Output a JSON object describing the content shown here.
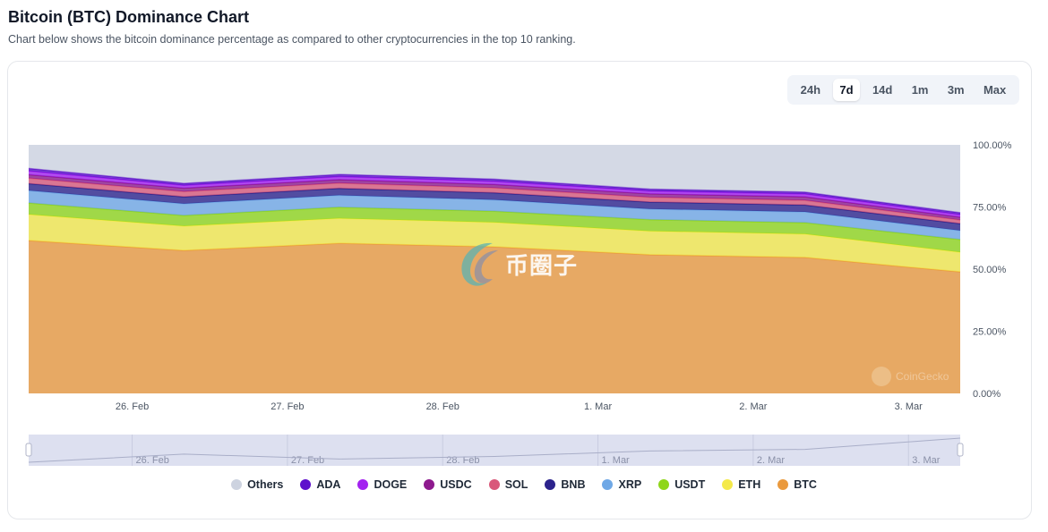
{
  "header": {
    "title": "Bitcoin (BTC) Dominance Chart",
    "subtitle": "Chart below shows the bitcoin dominance percentage as compared to other cryptocurrencies in the top 10 ranking."
  },
  "ranges": [
    {
      "label": "24h",
      "active": false
    },
    {
      "label": "7d",
      "active": true
    },
    {
      "label": "14d",
      "active": false
    },
    {
      "label": "1m",
      "active": false
    },
    {
      "label": "3m",
      "active": false
    },
    {
      "label": "Max",
      "active": false
    }
  ],
  "watermark": {
    "text": "币圈子",
    "brand": "CoinGecko"
  },
  "chart_data": {
    "type": "area",
    "stacked": true,
    "x": [
      "25 Feb 08:00",
      "26 Feb 08:00",
      "27 Feb 08:00",
      "28 Feb 08:00",
      "1 Mar 08:00",
      "2 Mar 08:00",
      "3 Mar 08:00"
    ],
    "x_tick_labels": [
      "26. Feb",
      "27. Feb",
      "28. Feb",
      "1. Mar",
      "2. Mar",
      "3. Mar"
    ],
    "y_tick_labels": [
      "0.00%",
      "25.00%",
      "50.00%",
      "75.00%",
      "100.00%"
    ],
    "ylim": [
      0,
      100
    ],
    "legend_position": "bottom",
    "series": [
      {
        "name": "BTC",
        "color": "#ea9a3e",
        "values": [
          61.5,
          57.5,
          60.4,
          59.0,
          55.8,
          54.7,
          48.9
        ]
      },
      {
        "name": "ETH",
        "color": "#f4e94a",
        "values": [
          10.5,
          9.8,
          10.0,
          9.8,
          9.5,
          9.4,
          7.9
        ]
      },
      {
        "name": "USDT",
        "color": "#8fd61a",
        "values": [
          4.6,
          4.3,
          4.5,
          4.5,
          4.6,
          4.6,
          5.1
        ]
      },
      {
        "name": "XRP",
        "color": "#6fa8e6",
        "values": [
          5.0,
          4.7,
          4.8,
          4.6,
          4.3,
          4.3,
          3.6
        ]
      },
      {
        "name": "BNB",
        "color": "#2c238c",
        "values": [
          2.8,
          2.8,
          2.8,
          2.8,
          2.8,
          2.8,
          2.8
        ]
      },
      {
        "name": "SOL",
        "color": "#d9587a",
        "values": [
          2.2,
          2.1,
          2.1,
          2.0,
          1.9,
          1.9,
          1.5
        ]
      },
      {
        "name": "USDC",
        "color": "#8e1a8e",
        "values": [
          1.4,
          1.4,
          1.4,
          1.4,
          1.4,
          1.4,
          1.1
        ]
      },
      {
        "name": "DOGE",
        "color": "#a322f0",
        "values": [
          1.5,
          1.1,
          1.2,
          1.2,
          1.1,
          1.1,
          1.0
        ]
      },
      {
        "name": "ADA",
        "color": "#5e10cc",
        "values": [
          1.0,
          0.8,
          0.9,
          0.9,
          0.8,
          0.8,
          0.8
        ]
      },
      {
        "name": "Others",
        "color": "#cdd3e0",
        "values": [
          9.5,
          15.5,
          11.9,
          13.8,
          17.8,
          19.0,
          27.3
        ]
      }
    ],
    "legend_order": [
      "Others",
      "ADA",
      "DOGE",
      "USDC",
      "SOL",
      "BNB",
      "XRP",
      "USDT",
      "ETH",
      "BTC"
    ]
  }
}
